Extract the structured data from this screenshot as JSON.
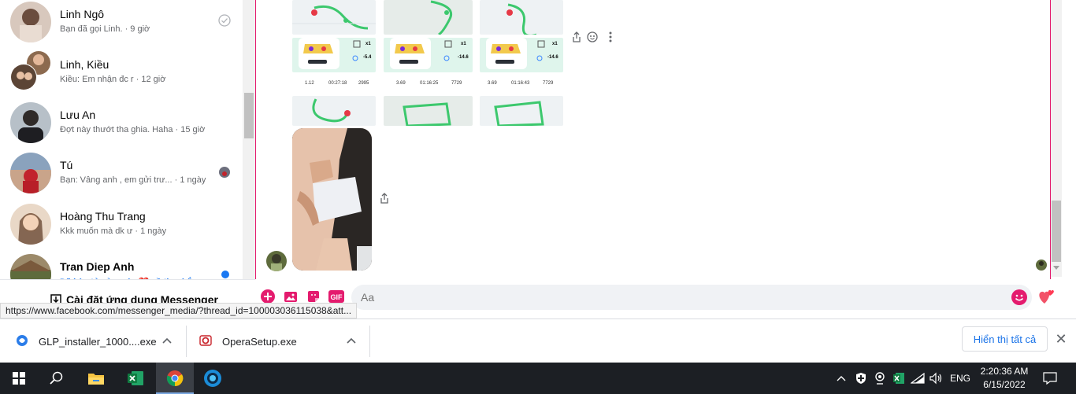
{
  "sidebar": {
    "conversations": [
      {
        "name": "Linh Ngô",
        "snippet": "Bạn đã gọi Linh.",
        "time": "· 9 giờ",
        "status": "seen-check"
      },
      {
        "name": "Linh, Kiều",
        "snippet": "Kiều: Em nhận đc r",
        "time": "· 12 giờ"
      },
      {
        "name": "Lưu An",
        "snippet": "Đợt này thướt tha ghia. Haha",
        "time": "· 15 giờ"
      },
      {
        "name": "Tú",
        "snippet": "Bạn: Vâng anh , em gửi trư...",
        "time": "· 1 ngày",
        "status": "seen-avatar"
      },
      {
        "name": "Hoàng Thu Trang",
        "snippet": "Kkk muốn mà dk ư",
        "time": "· 1 ngày"
      },
      {
        "name": "Tran Diep Anh",
        "snippet": "Đã bày tỏ cảm xúc ❤️ về tin nhắn...",
        "time": "",
        "status": "unread-dot",
        "unread": true
      }
    ],
    "install_label": "Cài đặt ứng dụng Messenger"
  },
  "chat": {
    "activity_stats": [
      {
        "distance": "1.12",
        "duration": "00:27:18",
        "steps": "2995",
        "score": "-5.4",
        "multiplier": "x1"
      },
      {
        "distance": "3.69",
        "duration": "01:16:25",
        "steps": "7729",
        "score": "-14.6",
        "multiplier": "x1"
      },
      {
        "distance": "3.69",
        "duration": "01:16:43",
        "steps": "7729",
        "score": "-14.6",
        "multiplier": "x1"
      }
    ],
    "input_placeholder": "Aa"
  },
  "status_url": "https://www.facebook.com/messenger_media/?thread_id=100003036115038&att...",
  "downloads": {
    "items": [
      {
        "name": "GLP_installer_1000....exe"
      },
      {
        "name": "OperaSetup.exe"
      }
    ],
    "show_all": "Hiển thị tất cả"
  },
  "taskbar": {
    "language": "ENG",
    "time": "2:20:36 AM",
    "date": "6/15/2022"
  },
  "colors": {
    "accent": "#e41b6e",
    "link": "#1877f2",
    "taskbar": "#1c1f24"
  }
}
